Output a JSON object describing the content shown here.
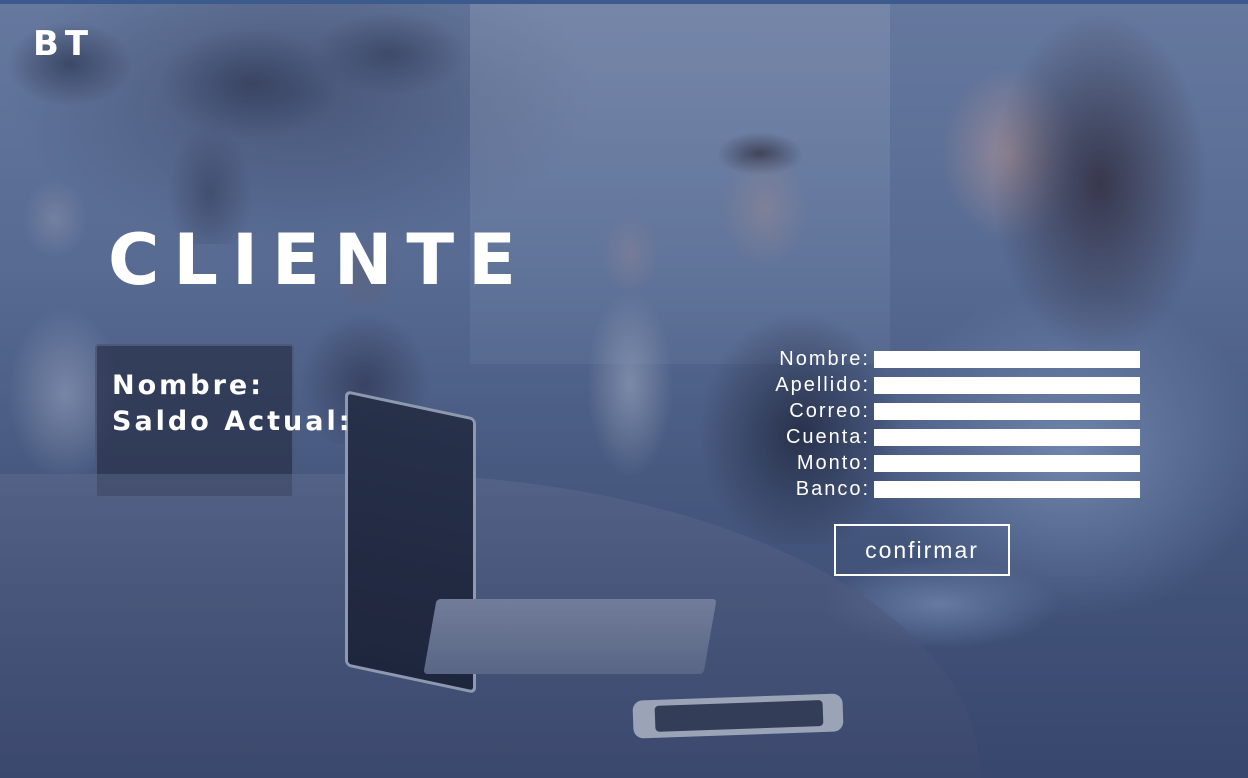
{
  "brand": {
    "logo_text": "BT"
  },
  "page": {
    "title": "CLIENTE"
  },
  "client_info": {
    "nombre_label": "Nombre:",
    "saldo_label": "Saldo Actual:"
  },
  "form": {
    "fields": [
      {
        "label": "Nombre:",
        "value": ""
      },
      {
        "label": "Apellido:",
        "value": ""
      },
      {
        "label": "Correo:",
        "value": ""
      },
      {
        "label": "Cuenta:",
        "value": ""
      },
      {
        "label": "Monto:",
        "value": ""
      },
      {
        "label": "Banco:",
        "value": ""
      }
    ],
    "confirm_label": "confirmar"
  },
  "colors": {
    "text": "#ffffff",
    "input_bg": "#ffffff",
    "overlay": "#3b4f78",
    "top_bar": "#3d5a8f"
  }
}
